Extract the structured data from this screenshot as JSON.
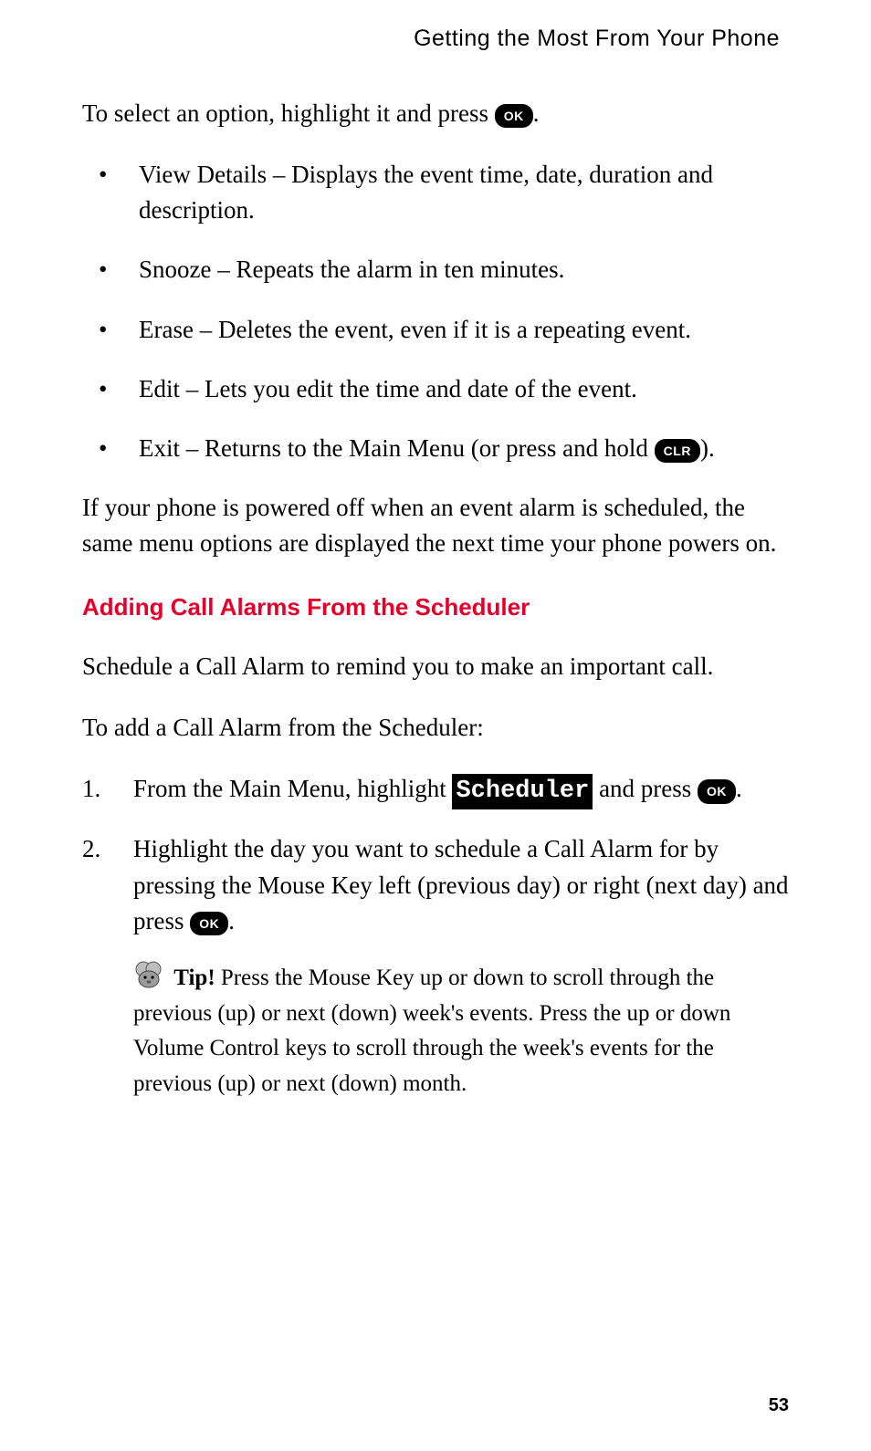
{
  "header": {
    "running_title": "Getting the Most From Your Phone"
  },
  "intro": {
    "before_key": "To select an option, highlight it and press ",
    "key": "OK",
    "after_key": "."
  },
  "bullets": [
    {
      "text": "View Details – Displays the event time, date, duration and description."
    },
    {
      "text": "Snooze – Repeats the alarm in ten minutes."
    },
    {
      "text": "Erase – Deletes the event, even if it is a repeating event."
    },
    {
      "text": "Edit – Lets you edit the time and date of the event."
    },
    {
      "before_key": "Exit – Returns to the Main Menu (or press and hold ",
      "key": "CLR",
      "after_key": ")."
    }
  ],
  "after_bullets": "If your phone is powered off when an event alarm is scheduled, the same menu options are displayed the next time your phone powers on.",
  "section": {
    "heading": "Adding Call Alarms From the Scheduler",
    "p1": "Schedule a Call Alarm to remind you to make an important call.",
    "p2": "To add a Call Alarm from the Scheduler:"
  },
  "steps": {
    "s1": {
      "before_screen": "From the Main Menu, highlight ",
      "screen": "Scheduler",
      "mid": " and press ",
      "key": "OK",
      "after_key": "."
    },
    "s2": {
      "before_key": "Highlight the day you want to schedule a Call Alarm for by pressing the Mouse Key left (previous day) or right (next day) and press ",
      "key": "OK",
      "after_key": "."
    },
    "tip": {
      "label": "Tip!",
      "text": " Press the Mouse Key up or down to scroll through the previous (up) or next (down) week's events. Press the up or down Volume Control keys to scroll through the week's events for the previous (up) or next (down) month."
    }
  },
  "page_number": "53"
}
